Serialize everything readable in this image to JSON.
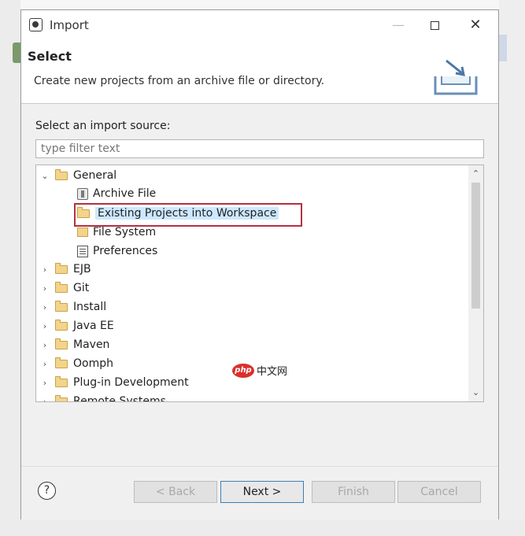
{
  "window": {
    "title": "Import",
    "controls": {
      "minimize": "—",
      "close": "✕"
    }
  },
  "header": {
    "title": "Select",
    "description": "Create new projects from an archive file or directory."
  },
  "content": {
    "source_label": "Select an import source:",
    "filter_placeholder": "type filter text",
    "tree": [
      {
        "label": "General",
        "expanded": true,
        "children": [
          {
            "label": "Archive File"
          },
          {
            "label": "Existing Projects into Workspace",
            "selected": true
          },
          {
            "label": "File System"
          },
          {
            "label": "Preferences"
          }
        ]
      },
      {
        "label": "EJB"
      },
      {
        "label": "Git"
      },
      {
        "label": "Install"
      },
      {
        "label": "Java EE"
      },
      {
        "label": "Maven"
      },
      {
        "label": "Oomph"
      },
      {
        "label": "Plug-in Development"
      },
      {
        "label": "Remote Systems"
      }
    ]
  },
  "watermark": {
    "badge": "php",
    "text": "中文网"
  },
  "footer": {
    "help": "?",
    "back": "< Back",
    "next": "Next >",
    "finish": "Finish",
    "cancel": "Cancel"
  },
  "colors": {
    "highlight_border": "#b3313e",
    "selection": "#cde8ff",
    "default_button_border": "#3c7fb1"
  }
}
